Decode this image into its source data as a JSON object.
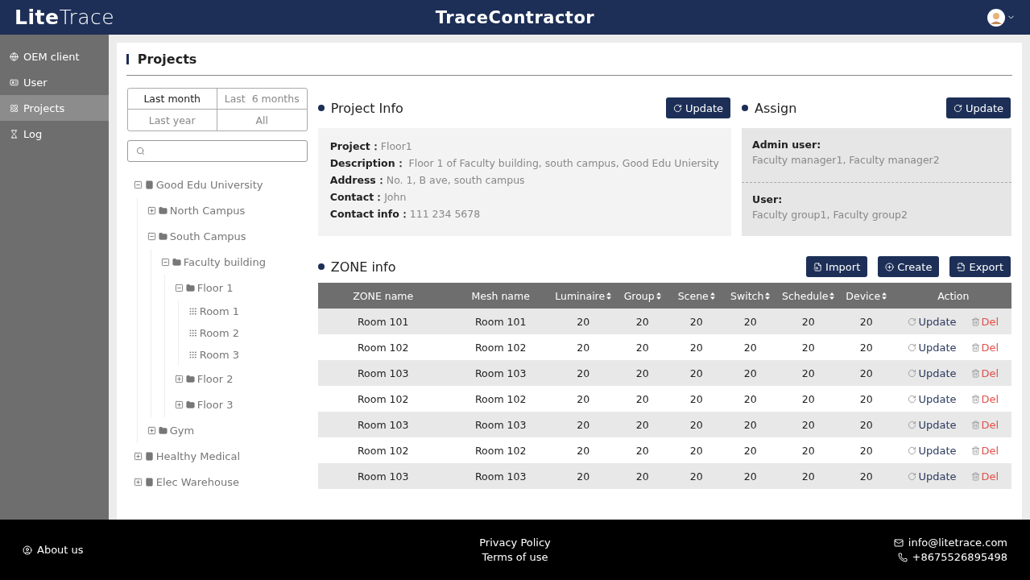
{
  "header": {
    "logo": "**Lite**Trace",
    "title": "TraceContractor"
  },
  "sidebar": {
    "items": [
      {
        "label": "OEM client",
        "kind": "globe",
        "selected": false
      },
      {
        "label": "User",
        "kind": "user",
        "selected": false
      },
      {
        "label": "Projects",
        "kind": "atom",
        "selected": true
      },
      {
        "label": "Log",
        "kind": "log",
        "selected": false
      }
    ]
  },
  "page_title": "Projects",
  "time_filter": [
    {
      "label": "Last month",
      "selected": true
    },
    {
      "label": "Last  6 months",
      "selected": false
    },
    {
      "label": "Last year",
      "selected": false
    },
    {
      "label": "All",
      "selected": false
    }
  ],
  "tree": [
    {
      "label": "Good Edu University",
      "kind": "site",
      "expanded": true,
      "children": [
        {
          "label": "North Campus",
          "kind": "folder",
          "expanded": false
        },
        {
          "label": "South Campus",
          "kind": "folder",
          "expanded": true,
          "children": [
            {
              "label": "Faculty building",
              "kind": "folder",
              "expanded": true,
              "children": [
                {
                  "label": "Floor 1",
                  "kind": "folder",
                  "expanded": true,
                  "children": [
                    {
                      "label": "Room 1",
                      "kind": "room"
                    },
                    {
                      "label": "Room 2",
                      "kind": "room"
                    },
                    {
                      "label": "Room 3",
                      "kind": "room"
                    }
                  ]
                },
                {
                  "label": "Floor 2",
                  "kind": "folder",
                  "expanded": false
                },
                {
                  "label": "Floor 3",
                  "kind": "folder",
                  "expanded": false
                }
              ]
            }
          ]
        },
        {
          "label": "Gym",
          "kind": "folder",
          "expanded": false
        }
      ]
    },
    {
      "label": "Healthy Medical",
      "kind": "site",
      "expanded": false
    },
    {
      "label": "Elec Warehouse",
      "kind": "site",
      "expanded": false
    }
  ],
  "project_info": {
    "title": "Project Info",
    "button": "Update",
    "fields": [
      {
        "label": "Project：",
        "value": "Floor1"
      },
      {
        "label": "Description：",
        "value": " Floor 1 of Faculty building, south campus, Good Edu Uniersity"
      },
      {
        "label": "Address：",
        "value": "No. 1, B ave, south campus"
      },
      {
        "label": "Contact：",
        "value": "John"
      },
      {
        "label": "Contact info：",
        "value": "111 234 5678"
      }
    ]
  },
  "assign": {
    "title": "Assign",
    "button": "Update",
    "groups": [
      {
        "label": "Admin user:",
        "value": "Faculty manager1, Faculty manager2"
      },
      {
        "label": "User:",
        "value": "Faculty group1, Faculty group2"
      }
    ]
  },
  "zone_info": {
    "title": "ZONE info",
    "buttons": [
      {
        "label": "Import",
        "kind": "import"
      },
      {
        "label": "Create",
        "kind": "create"
      },
      {
        "label": "Export",
        "kind": "export"
      }
    ],
    "columns": [
      {
        "label": "ZONE name",
        "sortable": false
      },
      {
        "label": "Mesh name",
        "sortable": false
      },
      {
        "label": "Luminaire",
        "sortable": true
      },
      {
        "label": "Group",
        "sortable": true
      },
      {
        "label": "Scene",
        "sortable": true
      },
      {
        "label": "Switch",
        "sortable": true
      },
      {
        "label": "Schedule",
        "sortable": true
      },
      {
        "label": "Device",
        "sortable": true
      },
      {
        "label": "Action",
        "sortable": false
      }
    ],
    "rows": [
      {
        "cells": [
          "Room 101",
          "Room 101",
          "20",
          "20",
          "20",
          "20",
          "20",
          "20"
        ],
        "update": "Update",
        "delete": "Del"
      },
      {
        "cells": [
          "Room 102",
          "Room 102",
          "20",
          "20",
          "20",
          "20",
          "20",
          "20"
        ],
        "update": "Update",
        "delete": "Del"
      },
      {
        "cells": [
          "Room 103",
          "Room 103",
          "20",
          "20",
          "20",
          "20",
          "20",
          "20"
        ],
        "update": "Update",
        "delete": "Del"
      },
      {
        "cells": [
          "Room 102",
          "Room 102",
          "20",
          "20",
          "20",
          "20",
          "20",
          "20"
        ],
        "update": "Update",
        "delete": "Del"
      },
      {
        "cells": [
          "Room 103",
          "Room 103",
          "20",
          "20",
          "20",
          "20",
          "20",
          "20"
        ],
        "update": "Update",
        "delete": "Del"
      },
      {
        "cells": [
          "Room 102",
          "Room 102",
          "20",
          "20",
          "20",
          "20",
          "20",
          "20"
        ],
        "update": "Update",
        "delete": "Del"
      },
      {
        "cells": [
          "Room 103",
          "Room 103",
          "20",
          "20",
          "20",
          "20",
          "20",
          "20"
        ],
        "update": "Update",
        "delete": "Del"
      }
    ]
  },
  "footer": {
    "about": "About us",
    "links": [
      "Privacy Policy",
      "Terms of use"
    ],
    "email": "info@litetrace.com",
    "phone": "+8675526895498"
  }
}
